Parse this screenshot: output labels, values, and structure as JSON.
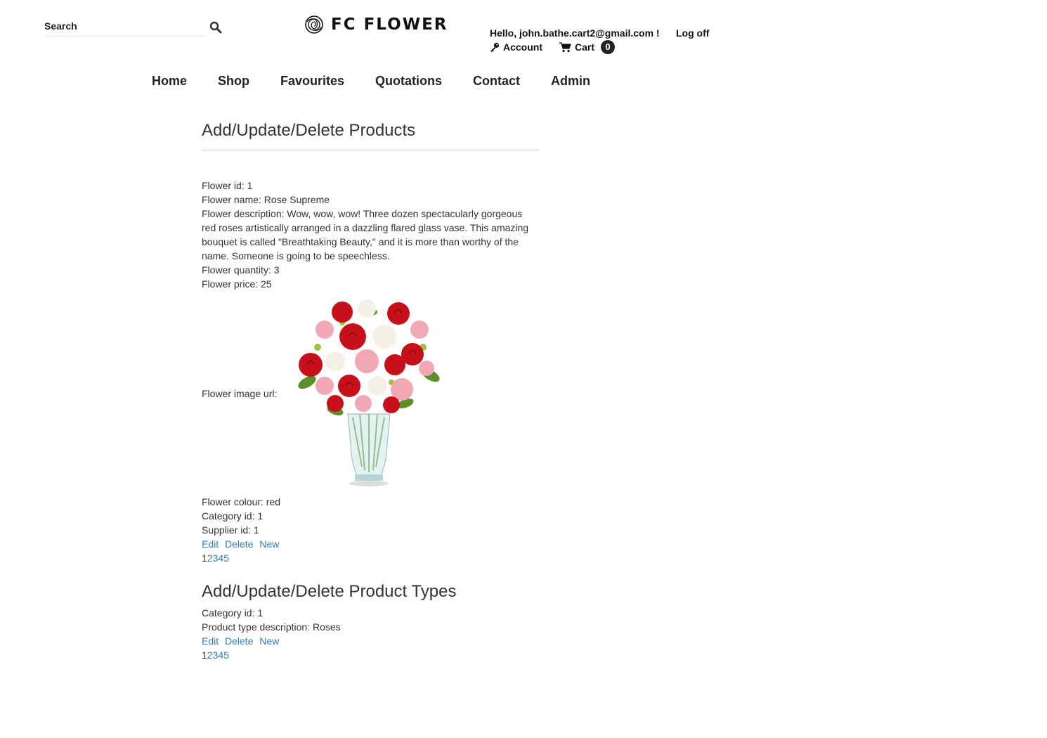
{
  "header": {
    "search_placeholder": "Search",
    "logo_text": "FC FLOWER",
    "greeting": "Hello, john.bathe.cart2@gmail.com !",
    "logoff_label": "Log off",
    "account_label": "Account",
    "cart_label": "Cart",
    "cart_count": "0"
  },
  "nav": {
    "items": [
      "Home",
      "Shop",
      "Favourites",
      "Quotations",
      "Contact",
      "Admin"
    ]
  },
  "products": {
    "title": "Add/Update/Delete Products",
    "flower_id": "Flower id: 1",
    "flower_name": "Flower name: Rose Supreme",
    "flower_description": "Flower description: Wow, wow, wow! Three dozen spectacularly gorgeous red roses artistically arranged in a dazzling flared glass vase. This amazing bouquet is called \"Breathtaking Beauty,\" and it is more than worthy of the name. Someone is going to be speechless.",
    "flower_quantity": "Flower quantity: 3",
    "flower_price": "Flower price: 25",
    "flower_image_label": "Flower image url:",
    "flower_colour": "Flower colour: red",
    "category_id": "Category id: 1",
    "supplier_id": "Supplier id: 1",
    "actions": [
      "Edit",
      "Delete",
      "New"
    ],
    "pager": [
      "1",
      "2",
      "3",
      "4",
      "5"
    ]
  },
  "product_types": {
    "title": "Add/Update/Delete Product Types",
    "category_id": "Category id: 1",
    "description": "Product type description: Roses",
    "actions": [
      "Edit",
      "Delete",
      "New"
    ],
    "pager": [
      "1",
      "2",
      "3",
      "4",
      "5"
    ]
  },
  "colors": {
    "link": "#337ab7",
    "text": "#333333",
    "rose_red": "#c8101a",
    "rose_pink": "#f2a7b5",
    "rose_white": "#f4f0e6"
  },
  "icons": {
    "search": "search-icon",
    "logo": "rose-logo-icon",
    "account": "key-icon",
    "cart": "cart-icon"
  }
}
